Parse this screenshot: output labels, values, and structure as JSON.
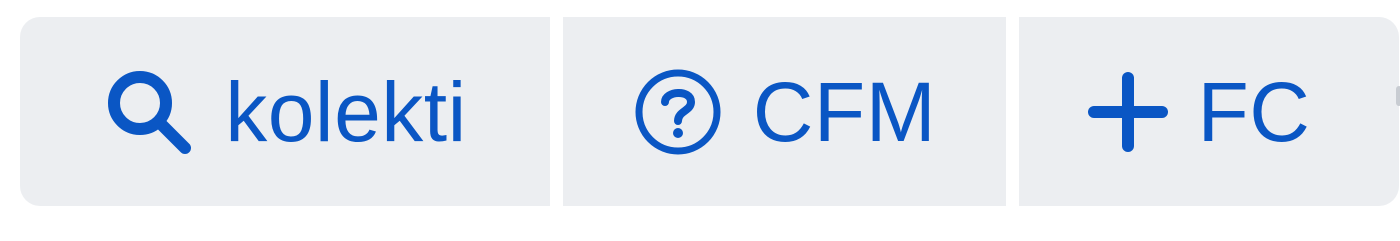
{
  "toolbar": {
    "accent_color": "#0a56c4",
    "button_background": "#eceef1",
    "buttons": [
      {
        "label": "kolekti",
        "icon": "search-icon"
      },
      {
        "label": "CFM",
        "icon": "help-circle-icon"
      },
      {
        "label": "FC",
        "icon": "plus-icon"
      }
    ]
  }
}
